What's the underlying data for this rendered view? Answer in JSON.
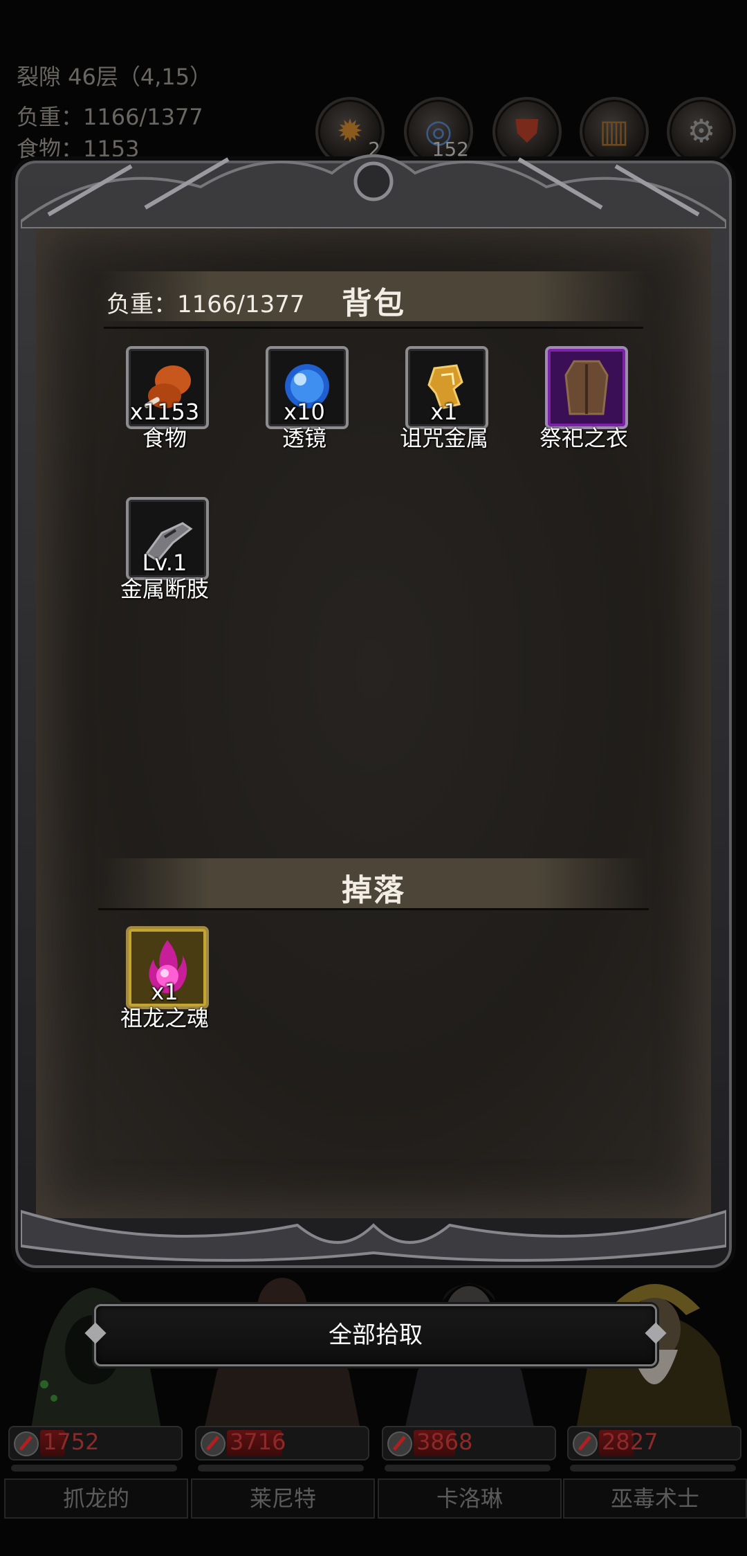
{
  "hud": {
    "location": "裂隙 46层（4,15）",
    "load": "负重：1166/1377",
    "food": "食物：1153"
  },
  "top_buttons": [
    {
      "label": "扎营",
      "badge": "2",
      "icon": "campfire-icon"
    },
    {
      "label": "回城",
      "badge": "152",
      "icon": "portal-icon"
    },
    {
      "label": "佣兵",
      "badge": "",
      "icon": "shield-icon"
    },
    {
      "label": "背包",
      "badge": "",
      "icon": "barrel-icon"
    },
    {
      "label": "设置",
      "badge": "",
      "icon": "gear-icon"
    }
  ],
  "bag": {
    "title": "背包",
    "load": "负重：1166/1377",
    "items": [
      {
        "name": "食物",
        "qty": "x1153",
        "icon": "drumstick-icon"
      },
      {
        "name": "透镜",
        "qty": "x10",
        "icon": "blue-orb-icon"
      },
      {
        "name": "诅咒金属",
        "qty": "x1",
        "icon": "gold-metal-icon"
      },
      {
        "name": "祭祀之衣",
        "qty": "",
        "icon": "robe-icon",
        "rarity_color": "#7d22a8"
      },
      {
        "name": "金属断肢",
        "qty": "Lv.1",
        "icon": "metal-arm-icon"
      }
    ]
  },
  "drops": {
    "title": "掉落",
    "items": [
      {
        "name": "祖龙之魂",
        "qty": "x1",
        "icon": "pink-flame-orb-icon",
        "rarity_color": "#c5a532"
      }
    ]
  },
  "pickup_all": "全部拾取",
  "heroes": [
    {
      "name": "抓龙的",
      "hp": "1752",
      "hp_fraction": 0.18
    },
    {
      "name": "莱尼特",
      "hp": "3716",
      "hp_fraction": 0.4
    },
    {
      "name": "卡洛琳",
      "hp": "3868",
      "hp_fraction": 0.3
    },
    {
      "name": "巫毒术士",
      "hp": "2827",
      "hp_fraction": 0.25
    }
  ],
  "colors": {
    "panel_bg": "#201d1a",
    "section_bar": "#4c4538",
    "hp_text": "#8c2a2a",
    "epic_purple": "#7d22a8",
    "legendary_gold": "#c5a532"
  }
}
